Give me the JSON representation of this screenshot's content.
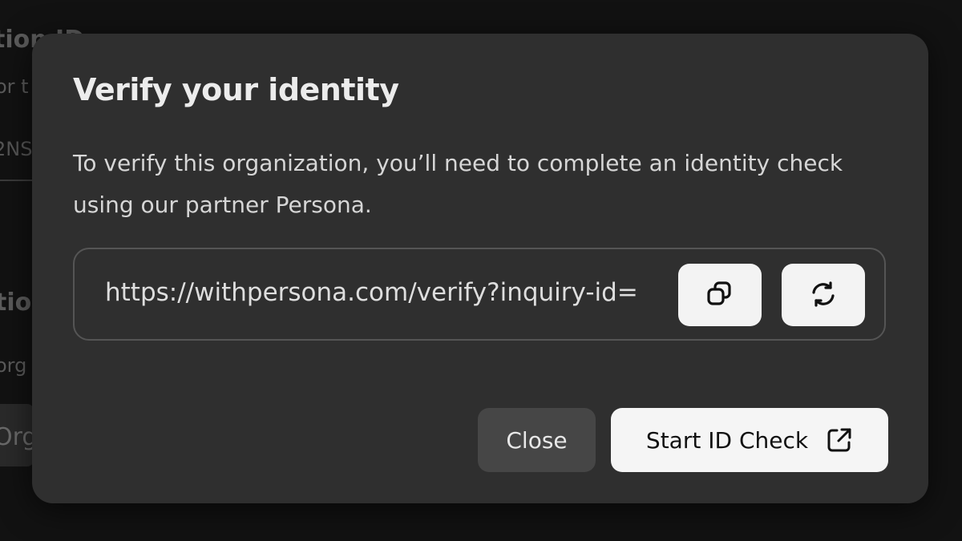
{
  "background": {
    "title_1": "tion ID",
    "subtitle_1": "or t",
    "code": "2NS",
    "title_2": "tio",
    "subtitle_2": "org",
    "button": "Org"
  },
  "modal": {
    "title": "Verify your identity",
    "description": "To verify this organization, you’ll need to complete an identity check using our partner Persona.",
    "url": "https://withpersona.com/verify?inquiry-id=",
    "copy_icon": "copy-icon",
    "refresh_icon": "refresh-icon",
    "close_label": "Close",
    "start_label": "Start ID Check",
    "start_icon": "external-link-icon"
  },
  "colors": {
    "page_bg": "#121212",
    "modal_bg": "#2f2f2f",
    "close_btn_bg": "#464646",
    "primary_btn_bg": "#f5f5f5"
  }
}
